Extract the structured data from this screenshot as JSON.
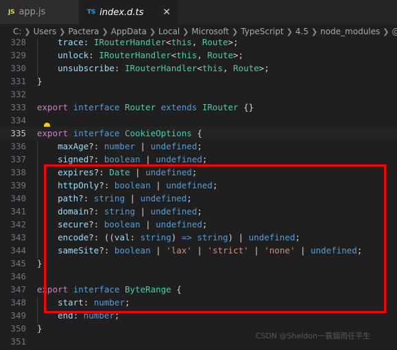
{
  "window": {
    "app": "Visual Studio Code",
    "theme_bg": "#1f1f1f",
    "accent": "#ff0000"
  },
  "tabs": [
    {
      "label": "app.js",
      "icon": "js-file-icon",
      "icon_text": "JS",
      "icon_color": "#e8d44d",
      "active": false,
      "closeable": false
    },
    {
      "label": "index.d.ts",
      "icon": "ts-file-icon",
      "icon_text": "TS",
      "icon_color": "#3b9ad9",
      "active": true,
      "closeable": true,
      "close_glyph": "✕"
    }
  ],
  "breadcrumb": {
    "separator": "❯",
    "items": [
      "C:",
      "Users",
      "Pactera",
      "AppData",
      "Local",
      "Microsoft",
      "TypeScript",
      "4.5",
      "node_modules",
      "@types"
    ]
  },
  "editor": {
    "current_line": 335,
    "lightbulb_line": 334,
    "lightbulb_name": "quick-fix-lightbulb-icon",
    "first_line": 328,
    "last_line": 351,
    "lines": [
      {
        "n": 328,
        "text": "    trace: IRouterHandler<this, Route>;"
      },
      {
        "n": 329,
        "text": "    unlock: IRouterHandler<this, Route>;"
      },
      {
        "n": 330,
        "text": "    unsubscribe: IRouterHandler<this, Route>;"
      },
      {
        "n": 331,
        "text": "}"
      },
      {
        "n": 332,
        "text": ""
      },
      {
        "n": 333,
        "text": "export interface Router extends IRouter {}"
      },
      {
        "n": 334,
        "text": ""
      },
      {
        "n": 335,
        "text": "export interface CookieOptions {"
      },
      {
        "n": 336,
        "text": "    maxAge?: number | undefined;"
      },
      {
        "n": 337,
        "text": "    signed?: boolean | undefined;"
      },
      {
        "n": 338,
        "text": "    expires?: Date | undefined;"
      },
      {
        "n": 339,
        "text": "    httpOnly?: boolean | undefined;"
      },
      {
        "n": 340,
        "text": "    path?: string | undefined;"
      },
      {
        "n": 341,
        "text": "    domain?: string | undefined;"
      },
      {
        "n": 342,
        "text": "    secure?: boolean | undefined;"
      },
      {
        "n": 343,
        "text": "    encode?: ((val: string) => string) | undefined;"
      },
      {
        "n": 344,
        "text": "    sameSite?: boolean | 'lax' | 'strict' | 'none' | undefined;"
      },
      {
        "n": 345,
        "text": "}"
      },
      {
        "n": 346,
        "text": ""
      },
      {
        "n": 347,
        "text": "export interface ByteRange {"
      },
      {
        "n": 348,
        "text": "    start: number;"
      },
      {
        "n": 349,
        "text": "    end: number;"
      },
      {
        "n": 350,
        "text": "}"
      },
      {
        "n": 351,
        "text": ""
      }
    ]
  },
  "annotation": {
    "shape": "rectangle",
    "color": "#ff0000",
    "covers_lines": "335-345"
  },
  "watermark": {
    "text": "CSDN @Sheldon一蓑烟雨任平生"
  },
  "syntax_colors": {
    "keyword": "#c586c0",
    "keyword_blue": "#569cd6",
    "type": "#4ec9b0",
    "property": "#9cdcfe",
    "string": "#ce9178",
    "plain": "#d4d4d4",
    "line_number": "#6e7681",
    "line_number_active": "#c6c6c6"
  }
}
